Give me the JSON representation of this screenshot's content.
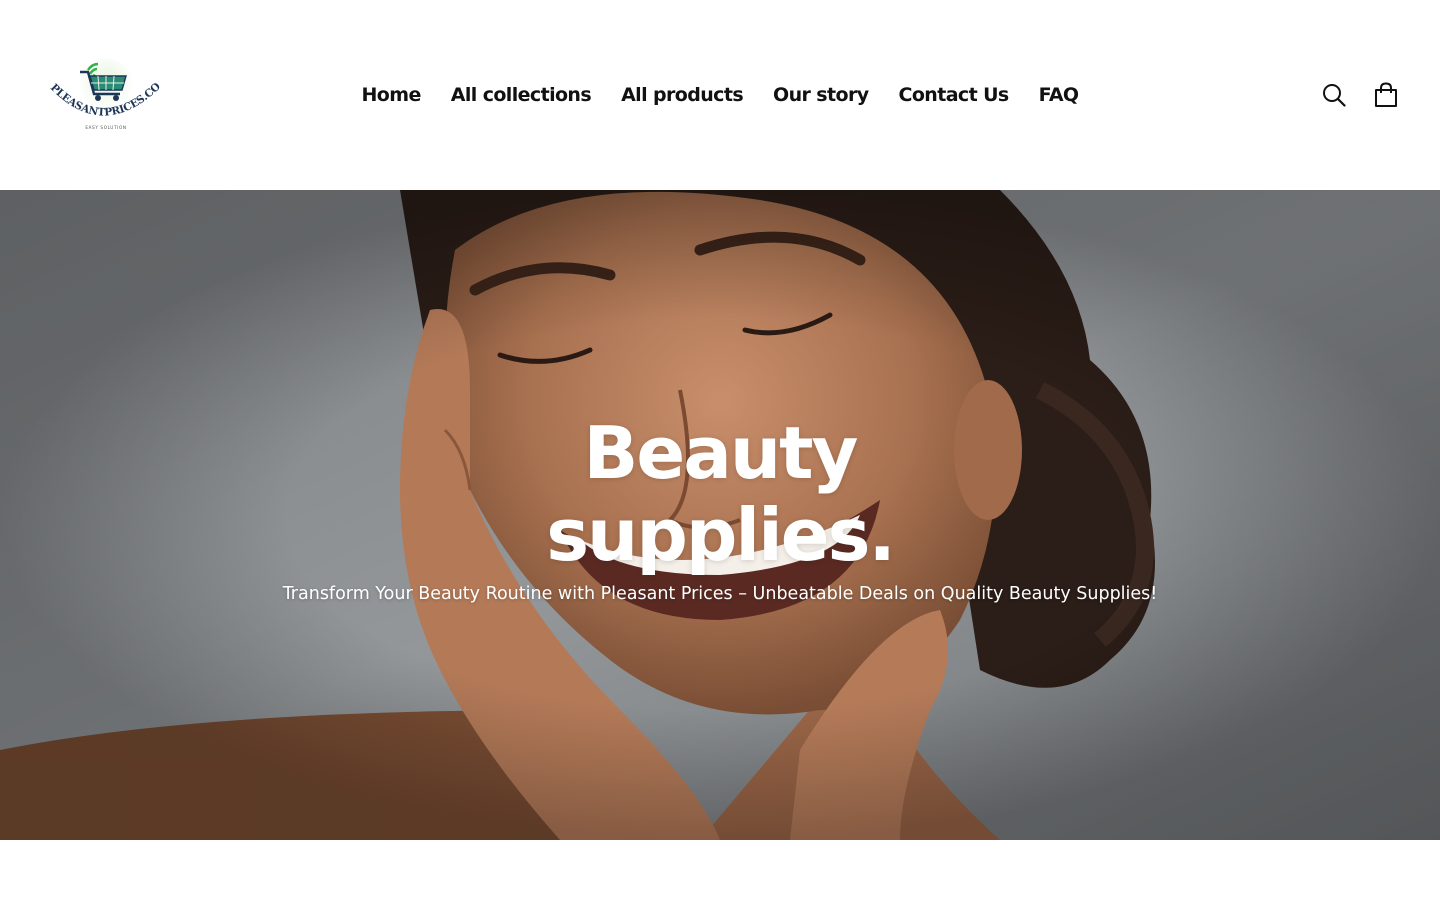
{
  "brand": {
    "logo_text": "PLEASANTPRICES.COM",
    "logo_tagline": "EASY SOLUTION"
  },
  "nav": {
    "items": [
      {
        "label": "Home"
      },
      {
        "label": "All collections"
      },
      {
        "label": "All products"
      },
      {
        "label": "Our story"
      },
      {
        "label": "Contact Us"
      },
      {
        "label": "FAQ"
      }
    ]
  },
  "header_icons": {
    "search": "search-icon",
    "cart": "cart-icon"
  },
  "hero": {
    "title_line1": "Beauty",
    "title_line2": "supplies.",
    "subtitle": "Transform Your Beauty Routine with Pleasant Prices – Unbeatable Deals on Quality Beauty Supplies!"
  },
  "colors": {
    "nav_text": "#111111",
    "hero_text": "#ffffff",
    "logo_navy": "#1d3557",
    "logo_green": "#2fb14a"
  }
}
